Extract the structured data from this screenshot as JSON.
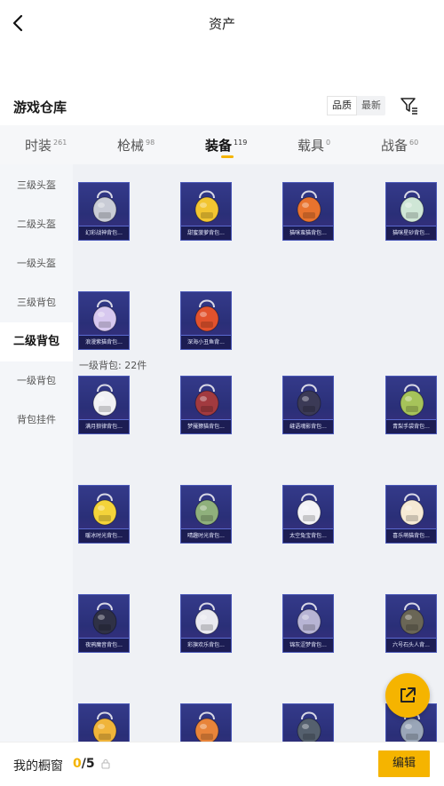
{
  "header": {
    "title": "资产",
    "back_icon": "chevron-left-icon"
  },
  "warehouse": {
    "title": "游戏仓库",
    "sort_options": [
      "品质",
      "最新"
    ],
    "sort_selected": "品质",
    "filter_icon": "filter-icon"
  },
  "tabs": [
    {
      "label": "时装",
      "count": "261",
      "active": false
    },
    {
      "label": "枪械",
      "count": "98",
      "active": false
    },
    {
      "label": "装备",
      "count": "119",
      "active": true
    },
    {
      "label": "载具",
      "count": "0",
      "active": false
    },
    {
      "label": "战备",
      "count": "60",
      "active": false
    }
  ],
  "sidebar": {
    "items": [
      {
        "label": "三级头盔",
        "active": false
      },
      {
        "label": "二级头盔",
        "active": false
      },
      {
        "label": "一级头盔",
        "active": false
      },
      {
        "label": "三级背包",
        "active": false
      },
      {
        "label": "二级背包",
        "active": true
      },
      {
        "label": "一级背包",
        "active": false
      },
      {
        "label": "背包挂件",
        "active": false
      }
    ]
  },
  "sections": {
    "level2": {
      "items": [
        {
          "name": "幻彩战神背包...",
          "color": "#c9ccd6"
        },
        {
          "name": "甜蜜菠萝背包...",
          "color": "#f2c531"
        },
        {
          "name": "猫咪蛮猫背包...",
          "color": "#e8732e"
        },
        {
          "name": "猫咪星砂背包...",
          "color": "#cfe6d6"
        },
        {
          "name": "浪漫紫猫背包...",
          "color": "#d7c8ef"
        },
        {
          "name": "深海小丑鱼背...",
          "color": "#e2522d"
        }
      ]
    },
    "level1": {
      "label": "一级背包: 22件",
      "items": [
        {
          "name": "满月狼律背包...",
          "color": "#f1f1f4"
        },
        {
          "name": "梦魇獠猫背包...",
          "color": "#a23a3f"
        },
        {
          "name": "缝语魂影背包...",
          "color": "#3b3a56"
        },
        {
          "name": "青梨手袋背包...",
          "color": "#a6c35a"
        },
        {
          "name": "暖冰时光背包...",
          "color": "#f4d33a"
        },
        {
          "name": "晴趣时光背包...",
          "color": "#8fb07c"
        },
        {
          "name": "太空兔宝背包...",
          "color": "#f3f3f6"
        },
        {
          "name": "喜乐萌猫背包...",
          "color": "#f6ead5"
        },
        {
          "name": "夜鸦魔音背包...",
          "color": "#2f3146"
        },
        {
          "name": "彩旗欢乐背包...",
          "color": "#e9e9ef"
        },
        {
          "name": "锦灰涩梦背包...",
          "color": "#b7b4d4"
        },
        {
          "name": "六号石头人背...",
          "color": "#6a6656"
        },
        {
          "name": "",
          "color": "#f0b43a"
        },
        {
          "name": "",
          "color": "#e8843a"
        },
        {
          "name": "",
          "color": "#55606e"
        },
        {
          "name": "",
          "color": "#9aa6b8"
        }
      ]
    }
  },
  "bottom": {
    "label": "我的橱窗",
    "count_current": "0",
    "count_total": "/5",
    "edit_label": "编辑"
  },
  "fab_icon": "share-external-icon"
}
